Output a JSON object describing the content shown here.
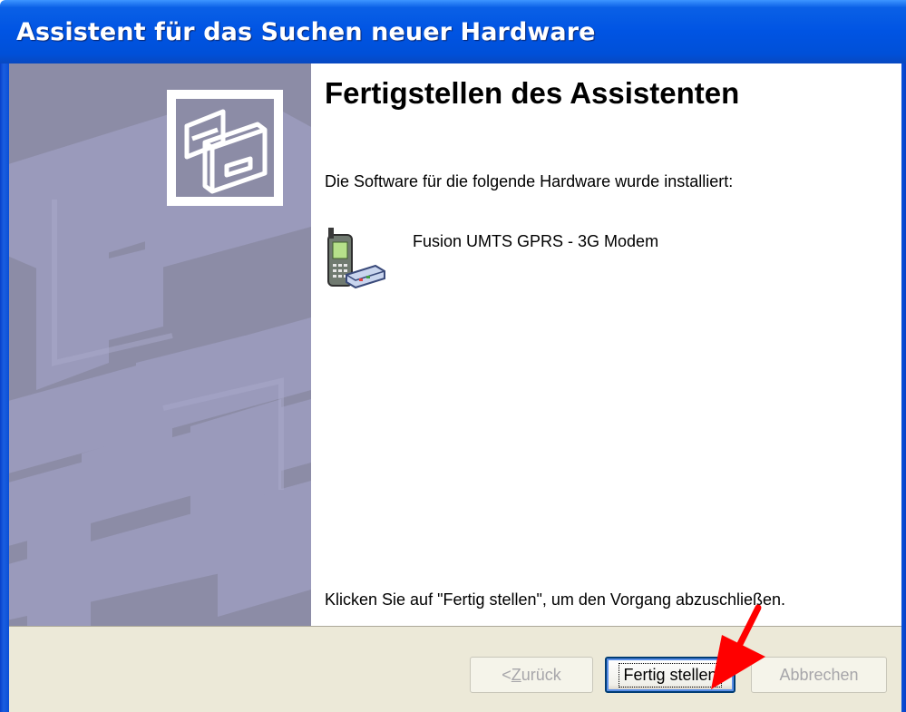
{
  "window": {
    "title": "Assistent für das Suchen neuer Hardware"
  },
  "page": {
    "heading": "Fertigstellen des Assistenten",
    "intro": "Die Software für die folgende Hardware wurde installiert:",
    "device_name": "Fusion UMTS GPRS - 3G Modem",
    "finish_instruction": "Klicken Sie auf \"Fertig stellen\", um den Vorgang abzuschließen."
  },
  "buttons": {
    "back_prefix": "< ",
    "back_mnemonic": "Z",
    "back_rest": "urück",
    "finish": "Fertig stellen",
    "cancel": "Abbrechen"
  },
  "icons": {
    "wizard": "hardware-card-icon",
    "device": "modem-phone-icon",
    "annotation": "red-arrow-icon"
  },
  "colors": {
    "titlebar": "#0054e3",
    "banner": "#8c8ca6",
    "footer": "#ece9d8",
    "arrow": "#ff0000"
  }
}
